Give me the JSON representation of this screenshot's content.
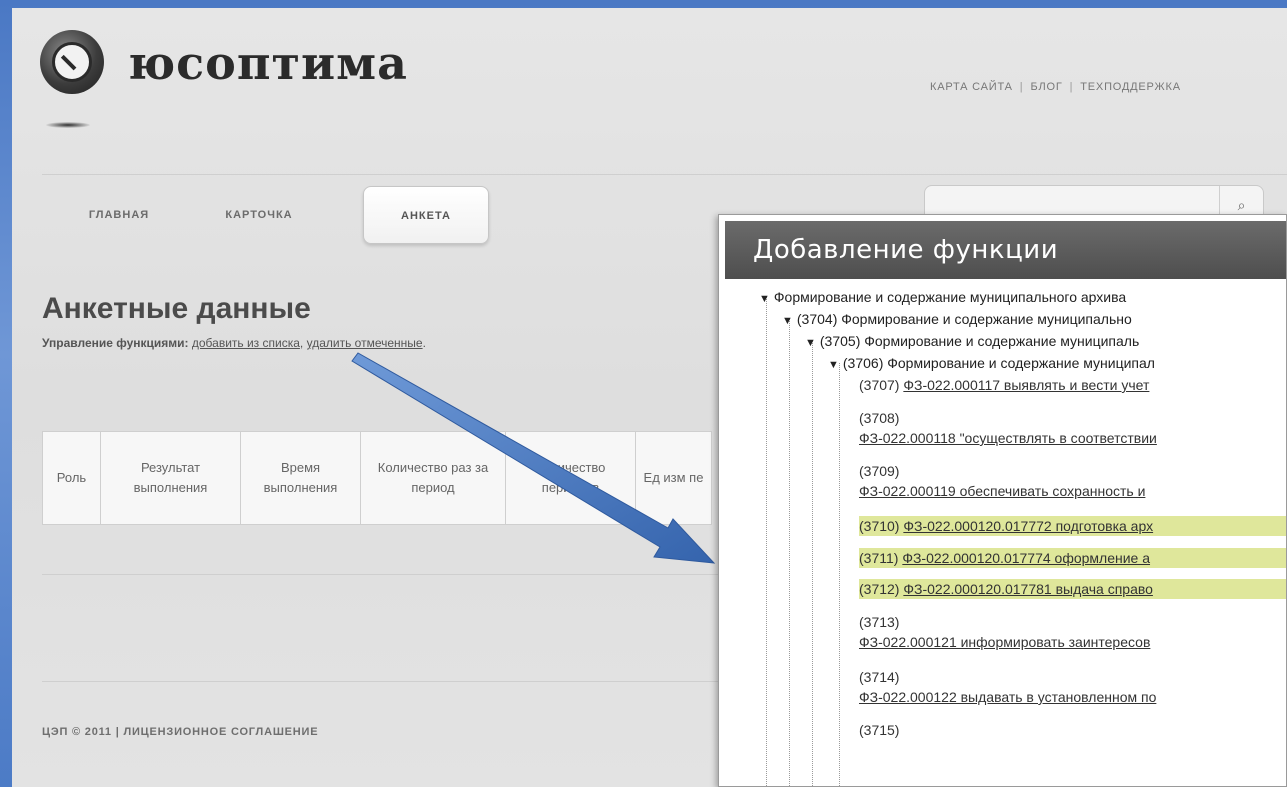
{
  "site": {
    "logo_text": "юсоптима",
    "top_links": [
      "КАРТА САЙТА",
      "БЛОГ",
      "ТЕХПОДДЕРЖКА"
    ],
    "link_separator": "|"
  },
  "nav": {
    "items": [
      "ГЛАВНАЯ",
      "КАРТОЧКА",
      "АНКЕТА"
    ],
    "active": "АНКЕТА"
  },
  "search": {
    "placeholder": "",
    "icon": "search-icon"
  },
  "main": {
    "title": "Анкетные данные",
    "func_label": "Управление функциями:",
    "add_link": "добавить из списка",
    "comma": ",",
    "delete_link": "удалить отмеченные",
    "period": ".",
    "table_headers": [
      "Роль",
      "Результат выполнения",
      "Время выполнения",
      "Количество раз за период",
      "Количество периодов",
      "Ед изм пе"
    ]
  },
  "footer": {
    "text": "ЦЭП © 2011 | ЛИЦЕНЗИОННОЕ СОГЛАШЕНИЕ"
  },
  "dialog": {
    "title": "Добавление функции",
    "tree": [
      {
        "level": 0,
        "code": "",
        "text": "Формирование и содержание муниципального архива"
      },
      {
        "level": 1,
        "code": "(3704)",
        "text": "Формирование и содержание муниципально"
      },
      {
        "level": 2,
        "code": "(3705)",
        "text": "Формирование и содержание муниципаль"
      },
      {
        "level": 3,
        "code": "(3706)",
        "text": "Формирование и содержание муниципал"
      }
    ],
    "leaves": [
      {
        "code": "(3707)",
        "text": "ФЗ-022.000117 выявлять и вести учет",
        "inline": true,
        "highlight": false
      },
      {
        "code": "(3708)",
        "text": "ФЗ-022.000118 \"осуществлять в соответствии",
        "inline": false,
        "highlight": false
      },
      {
        "code": "(3709)",
        "text": "ФЗ-022.000119 обеспечивать сохранность и",
        "inline": false,
        "highlight": false
      },
      {
        "code": "(3710)",
        "text": "ФЗ-022.000120.017772 подготовка арх",
        "inline": true,
        "highlight": true
      },
      {
        "code": "(3711)",
        "text": "ФЗ-022.000120.017774 оформление а",
        "inline": true,
        "highlight": true
      },
      {
        "code": "(3712)",
        "text": "ФЗ-022.000120.017781 выдача справо",
        "inline": true,
        "highlight": true
      },
      {
        "code": "(3713)",
        "text": "ФЗ-022.000121 информировать заинтересов",
        "inline": false,
        "highlight": false
      },
      {
        "code": "(3714)",
        "text": "ФЗ-022.000122 выдавать в установленном по",
        "inline": false,
        "highlight": false
      },
      {
        "code": "(3715)",
        "text": "",
        "inline": false,
        "highlight": false
      }
    ],
    "highlight_color": "#dfe79b"
  },
  "annotation": {
    "arrow_color": "#3d6fb6"
  }
}
